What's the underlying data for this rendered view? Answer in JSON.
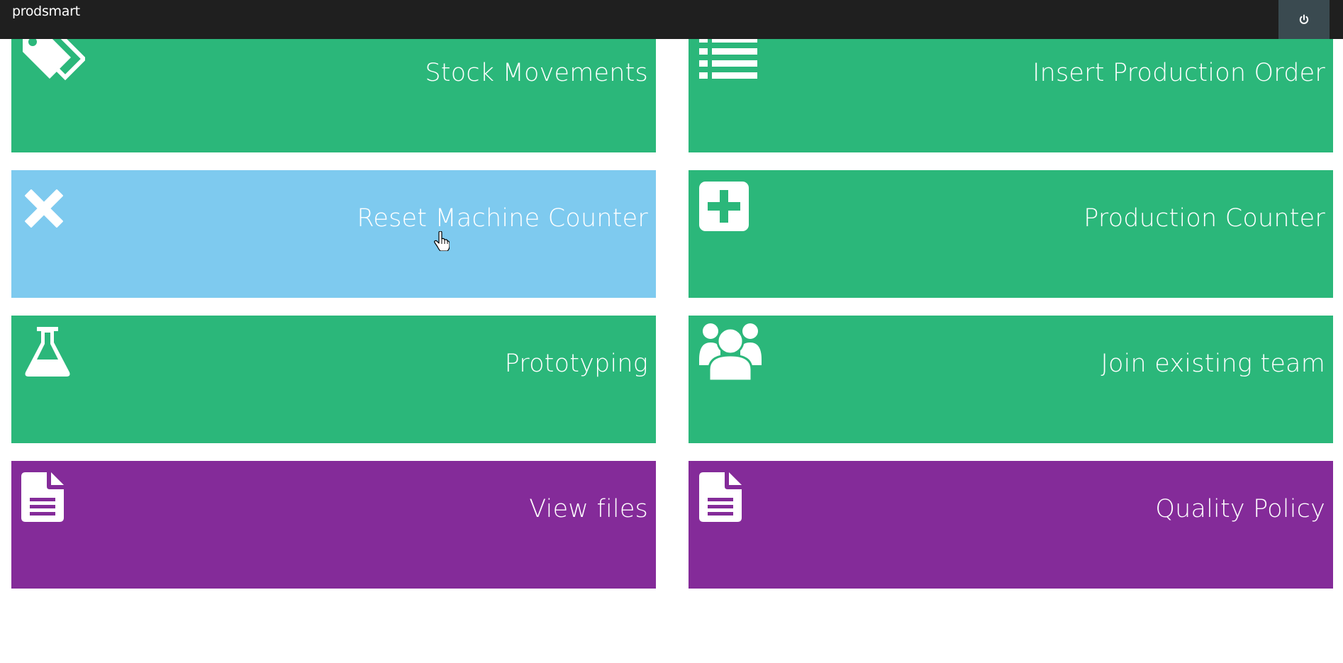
{
  "app": {
    "brand": "prodsmart",
    "power_icon": "power-icon"
  },
  "colors": {
    "topbar": "#1f1f1f",
    "power_button": "#3a4a50",
    "green": "#2bb77a",
    "blue": "#7ecaef",
    "purple": "#842b99"
  },
  "tiles": [
    {
      "label": "Stock Movements",
      "icon": "tags-icon",
      "color": "green"
    },
    {
      "label": "Insert Production Order",
      "icon": "list-icon",
      "color": "green"
    },
    {
      "label": "Reset Machine Counter",
      "icon": "close-icon",
      "color": "blue"
    },
    {
      "label": "Production Counter",
      "icon": "plus-square-icon",
      "color": "green"
    },
    {
      "label": "Prototyping",
      "icon": "flask-icon",
      "color": "green"
    },
    {
      "label": "Join existing team",
      "icon": "users-icon",
      "color": "green"
    },
    {
      "label": "View files",
      "icon": "file-icon",
      "color": "purple"
    },
    {
      "label": "Quality Policy",
      "icon": "file-icon",
      "color": "purple"
    }
  ]
}
